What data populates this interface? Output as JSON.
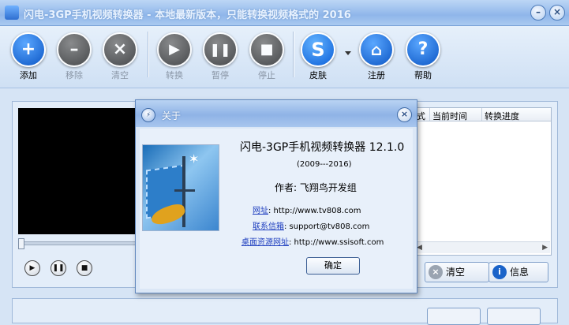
{
  "window": {
    "title": "闪电-3GP手机视频转换器 - 本地最新版本，只能转换视频格式的 2016",
    "minimize": "–",
    "close": "×"
  },
  "toolbar": {
    "add": "添加",
    "remove": "移除",
    "clear": "清空",
    "convert": "转换",
    "pause": "暂停",
    "stop": "停止",
    "skin": "皮肤",
    "register": "注册",
    "help": "帮助",
    "skin_glyph": "S"
  },
  "list": {
    "headers": [
      "式",
      "当前时间",
      "转换进度"
    ]
  },
  "side_buttons": {
    "clear": "清空",
    "info": "信息"
  },
  "dialog": {
    "title": "关于",
    "product": "闪电-3GP手机视频转换器 12.1.0",
    "years": "(2009---2016)",
    "author": "作者: 飞翔鸟开发组",
    "website_label": "网址",
    "website": ": http://www.tv808.com",
    "email_label": "联系信箱",
    "email": ": support@tv808.com",
    "desktop_label": "桌面资源网址",
    "desktop": ": http://www.ssisoft.com",
    "ok": "确定"
  },
  "icons": [
    "add-icon",
    "remove-icon",
    "clear-icon",
    "play-icon",
    "pause-icon",
    "stop-icon",
    "skin-icon",
    "home-icon",
    "help-icon"
  ]
}
